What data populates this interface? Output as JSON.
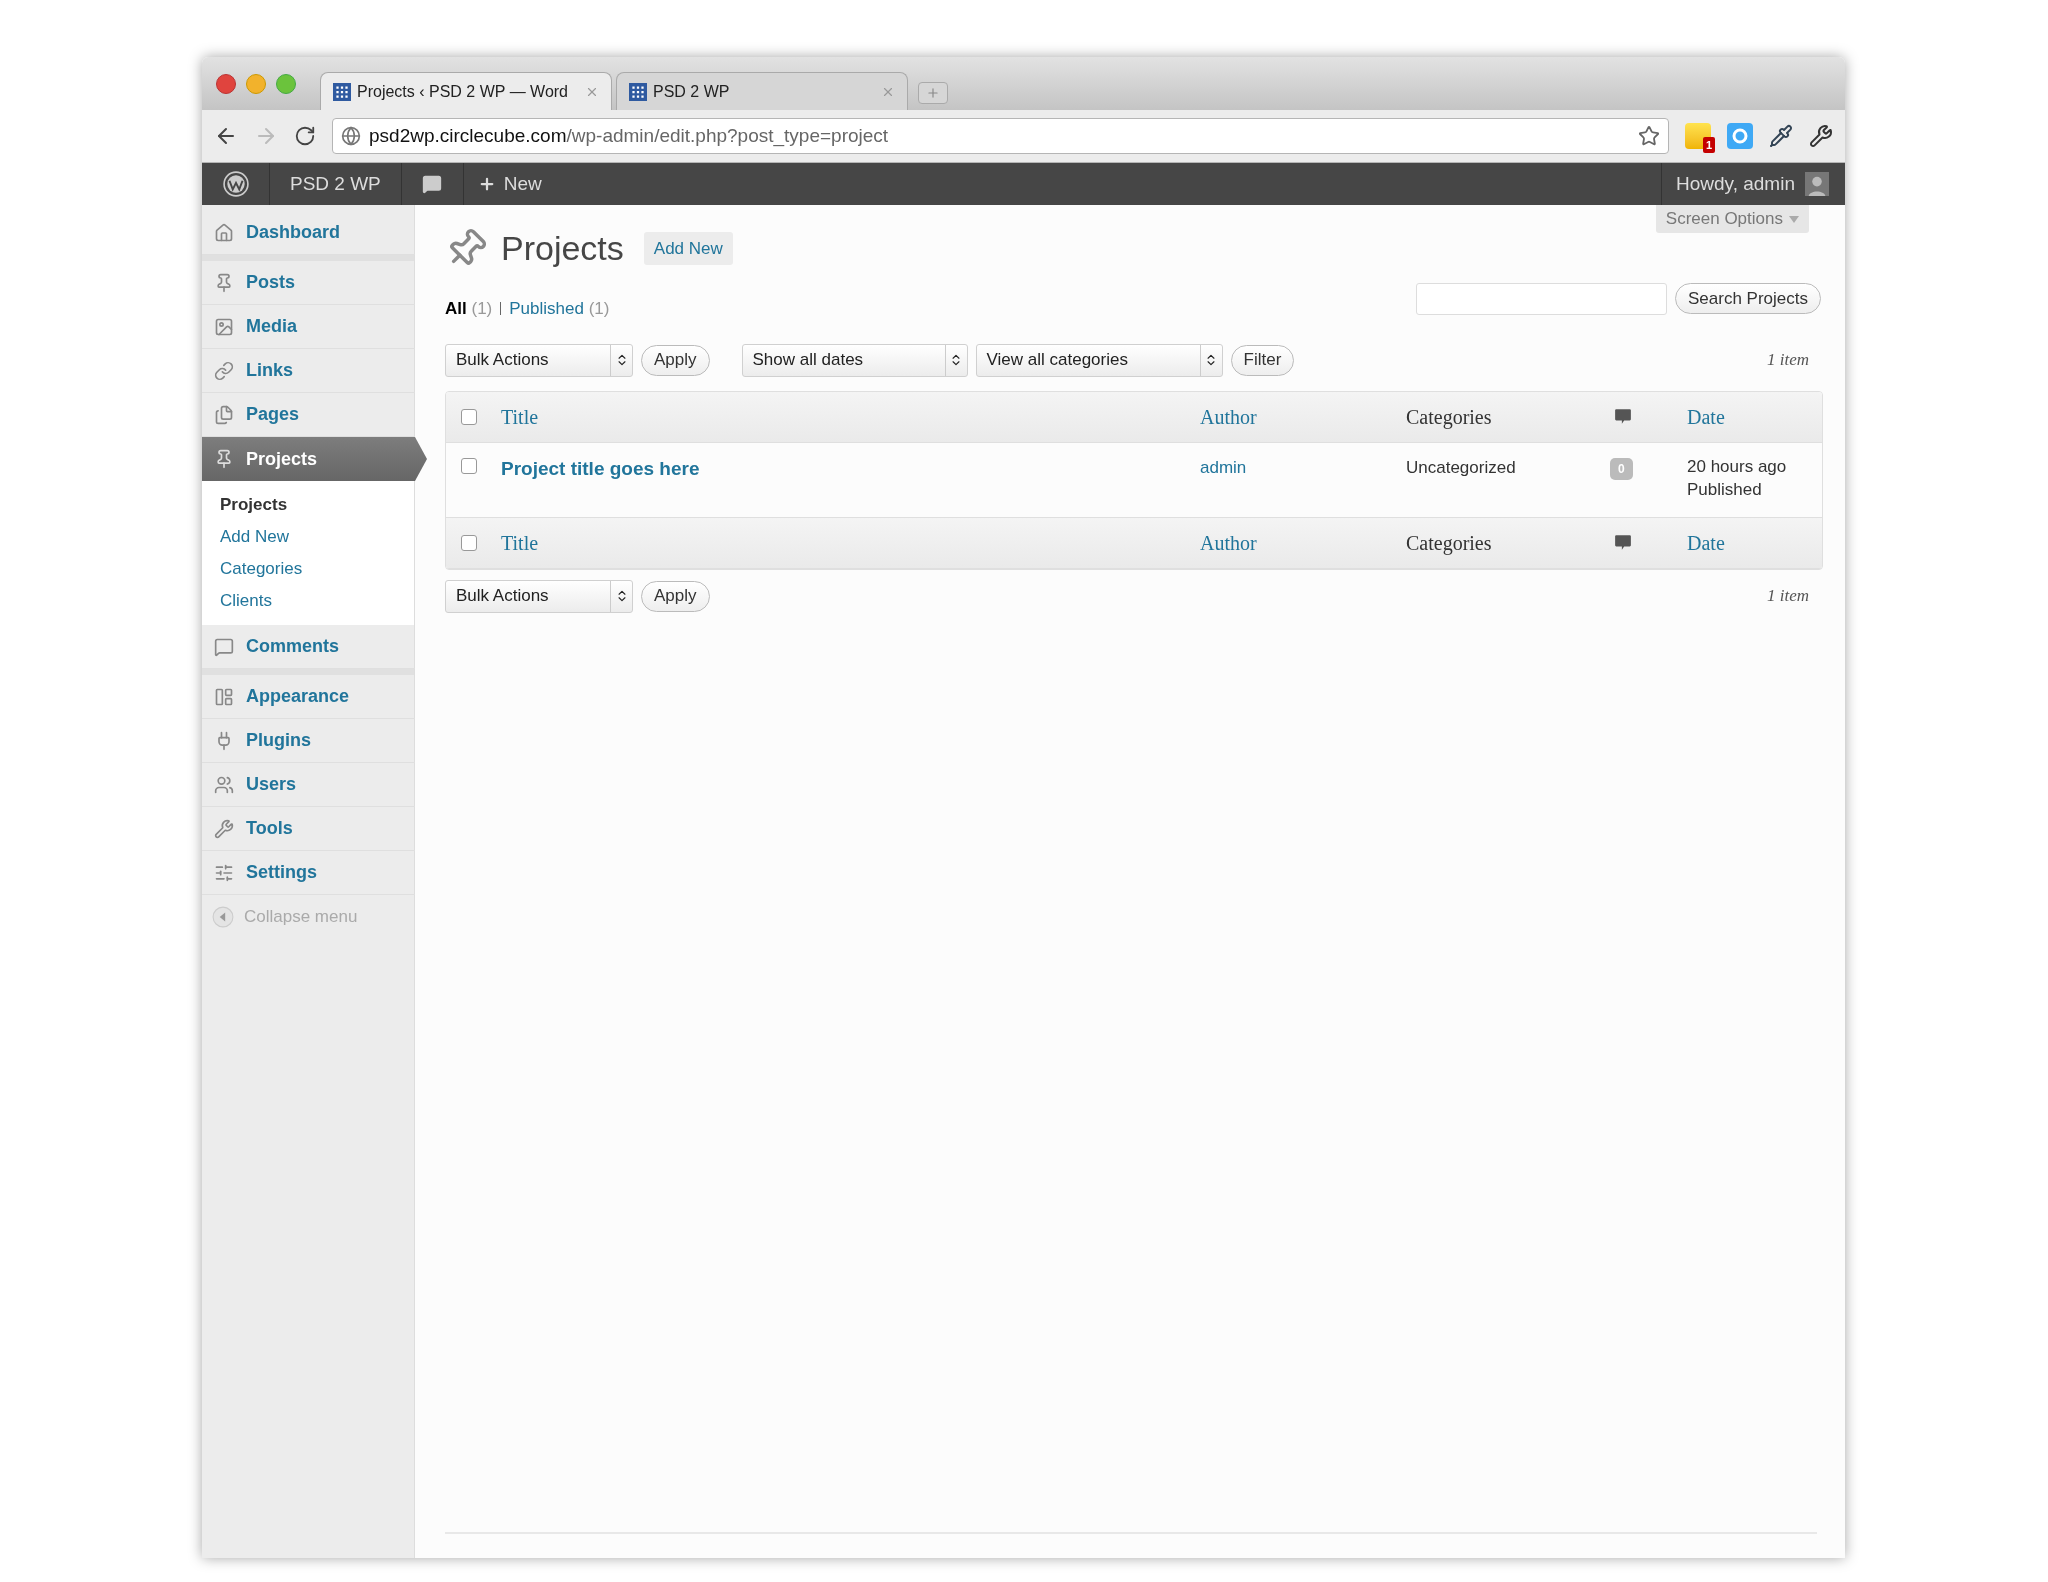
{
  "browser": {
    "tabs": [
      {
        "title": "Projects ‹ PSD 2 WP — Word",
        "selected": true
      },
      {
        "title": "PSD 2 WP",
        "selected": false
      }
    ],
    "url": {
      "host": "psd2wp.circlecube.com",
      "path": "/wp-admin/edit.php?post_type=project"
    },
    "extension_badge": "1"
  },
  "admin_bar": {
    "site_name": "PSD 2 WP",
    "new_label": "New",
    "greeting": "Howdy, admin"
  },
  "sidebar": {
    "groups": [
      {
        "items": [
          {
            "label": "Dashboard",
            "selected": false
          }
        ]
      },
      {
        "items": [
          {
            "label": "Posts",
            "selected": false
          },
          {
            "label": "Media",
            "selected": false
          },
          {
            "label": "Links",
            "selected": false
          },
          {
            "label": "Pages",
            "selected": false
          },
          {
            "label": "Projects",
            "selected": true,
            "children": [
              {
                "label": "Projects",
                "selected": true
              },
              {
                "label": "Add New",
                "selected": false
              },
              {
                "label": "Categories",
                "selected": false
              },
              {
                "label": "Clients",
                "selected": false
              }
            ]
          },
          {
            "label": "Comments",
            "selected": false
          }
        ]
      },
      {
        "items": [
          {
            "label": "Appearance",
            "selected": false
          },
          {
            "label": "Plugins",
            "selected": false
          },
          {
            "label": "Users",
            "selected": false
          },
          {
            "label": "Tools",
            "selected": false
          },
          {
            "label": "Settings",
            "selected": false
          }
        ]
      }
    ],
    "collapse_label": "Collapse menu"
  },
  "page": {
    "title": "Projects",
    "add_new": "Add New",
    "screen_options": "Screen Options",
    "views": [
      {
        "label": "All",
        "count": "(1)",
        "selected": true
      },
      {
        "label": "Published",
        "count": "(1)",
        "selected": false
      }
    ],
    "search_button": "Search Projects",
    "top_controls": {
      "bulk_actions": "Bulk Actions",
      "apply": "Apply",
      "dates": "Show all dates",
      "categories": "View all categories",
      "filter": "Filter",
      "item_count": "1 item"
    },
    "table": {
      "columns": [
        {
          "kind": "link",
          "label": "Title"
        },
        {
          "kind": "link",
          "label": "Author"
        },
        {
          "kind": "text",
          "label": "Categories"
        },
        {
          "kind": "icon"
        },
        {
          "kind": "link",
          "label": "Date"
        }
      ],
      "header_checked": false,
      "rows": [
        {
          "checked": false,
          "title": "Project title goes here",
          "author": "admin",
          "category": "Uncategorized",
          "comments": "0",
          "date": "20 hours ago",
          "status": "Published"
        }
      ],
      "footer_columns": [
        {
          "kind": "link",
          "label": "Title"
        },
        {
          "kind": "link",
          "label": "Author"
        },
        {
          "kind": "text",
          "label": "Categories"
        },
        {
          "kind": "icon"
        },
        {
          "kind": "link",
          "label": "Date"
        }
      ],
      "footer_checked": false
    },
    "bottom_controls": {
      "bulk_actions": "Bulk Actions",
      "apply": "Apply",
      "item_count": "1 item"
    }
  }
}
